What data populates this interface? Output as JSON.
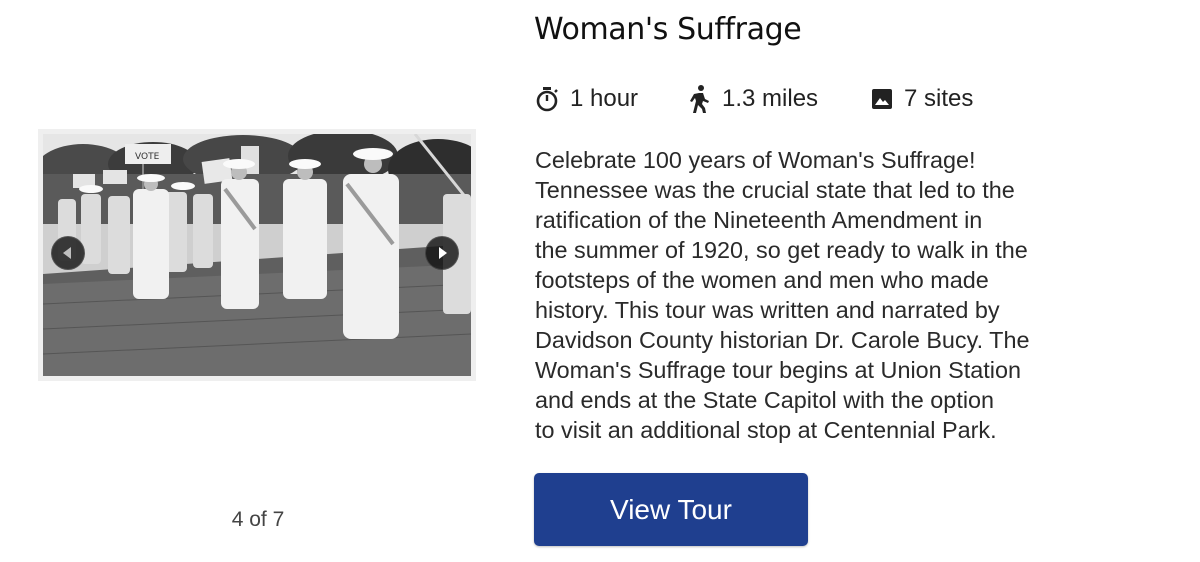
{
  "tour": {
    "title": "Woman's Suffrage",
    "duration": "1 hour",
    "distance": "1.3 miles",
    "sites": "7 sites",
    "description": "Celebrate 100 years of Woman's Suffrage!\nTennessee was the crucial state that led to the\nratification of the Nineteenth Amendment in\nthe summer of 1920, so get ready to walk in the\nfootsteps of the women and men who made\nhistory. This tour was written and narrated by\nDavidson County historian Dr. Carole Bucy. The\nWoman's Suffrage tour begins at Union Station\nand ends at the State Capitol with the option\nto visit an additional stop at Centennial Park.",
    "cta_label": "View Tour"
  },
  "carousel": {
    "counter": "4 of 7",
    "photo_sign_text": "VOTE",
    "icons": {
      "prev": "chevron-left-icon",
      "next": "chevron-right-icon"
    }
  },
  "meta_icons": {
    "duration": "stopwatch-icon",
    "distance": "walking-person-icon",
    "sites": "image-icon"
  },
  "colors": {
    "button_bg": "#1f3f8f",
    "button_text": "#ffffff"
  }
}
